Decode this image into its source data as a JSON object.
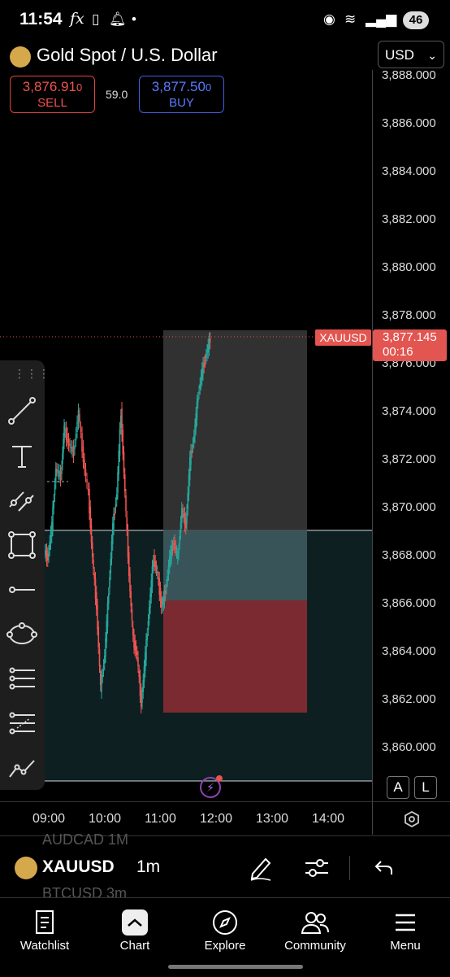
{
  "status": {
    "time": "11:54",
    "fx": "fx",
    "battery": "46"
  },
  "header": {
    "title": "Gold Spot / U.S. Dollar",
    "currency": "USD"
  },
  "sell": {
    "price_main": "3,876.91",
    "price_small": "0",
    "label": "SELL"
  },
  "buy": {
    "price_main": "3,877.50",
    "price_small": "0",
    "label": "BUY"
  },
  "spread": "59.0",
  "price_axis": {
    "ticks": [
      "3,888.000",
      "3,886.000",
      "3,884.000",
      "3,882.000",
      "3,880.000",
      "3,878.000",
      "3,876.000",
      "3,874.000",
      "3,872.000",
      "3,870.000",
      "3,868.000",
      "3,866.000",
      "3,864.000",
      "3,862.000",
      "3,860.000"
    ],
    "current_price": "3,877.145",
    "countdown": "00:16",
    "symbol_tag": "XAUUSD"
  },
  "time_axis": [
    "09:00",
    "10:00",
    "11:00",
    "12:00",
    "13:00",
    "14:00"
  ],
  "axis_buttons": {
    "auto": "A",
    "log": "L"
  },
  "toolbar": {
    "symbol": "XAUUSD",
    "interval": "1m",
    "ghost_top": "AUDCAD   1M",
    "ghost_bottom": "BTCUSD   3m"
  },
  "nav": [
    {
      "label": "Watchlist",
      "icon": "watchlist-icon"
    },
    {
      "label": "Chart",
      "icon": "chart-icon"
    },
    {
      "label": "Explore",
      "icon": "compass-icon"
    },
    {
      "label": "Community",
      "icon": "community-icon"
    },
    {
      "label": "Menu",
      "icon": "menu-icon"
    }
  ],
  "colors": {
    "up": "#26a69a",
    "down": "#ef5350",
    "accent": "#e35550",
    "buy": "#3f5fe0"
  }
}
